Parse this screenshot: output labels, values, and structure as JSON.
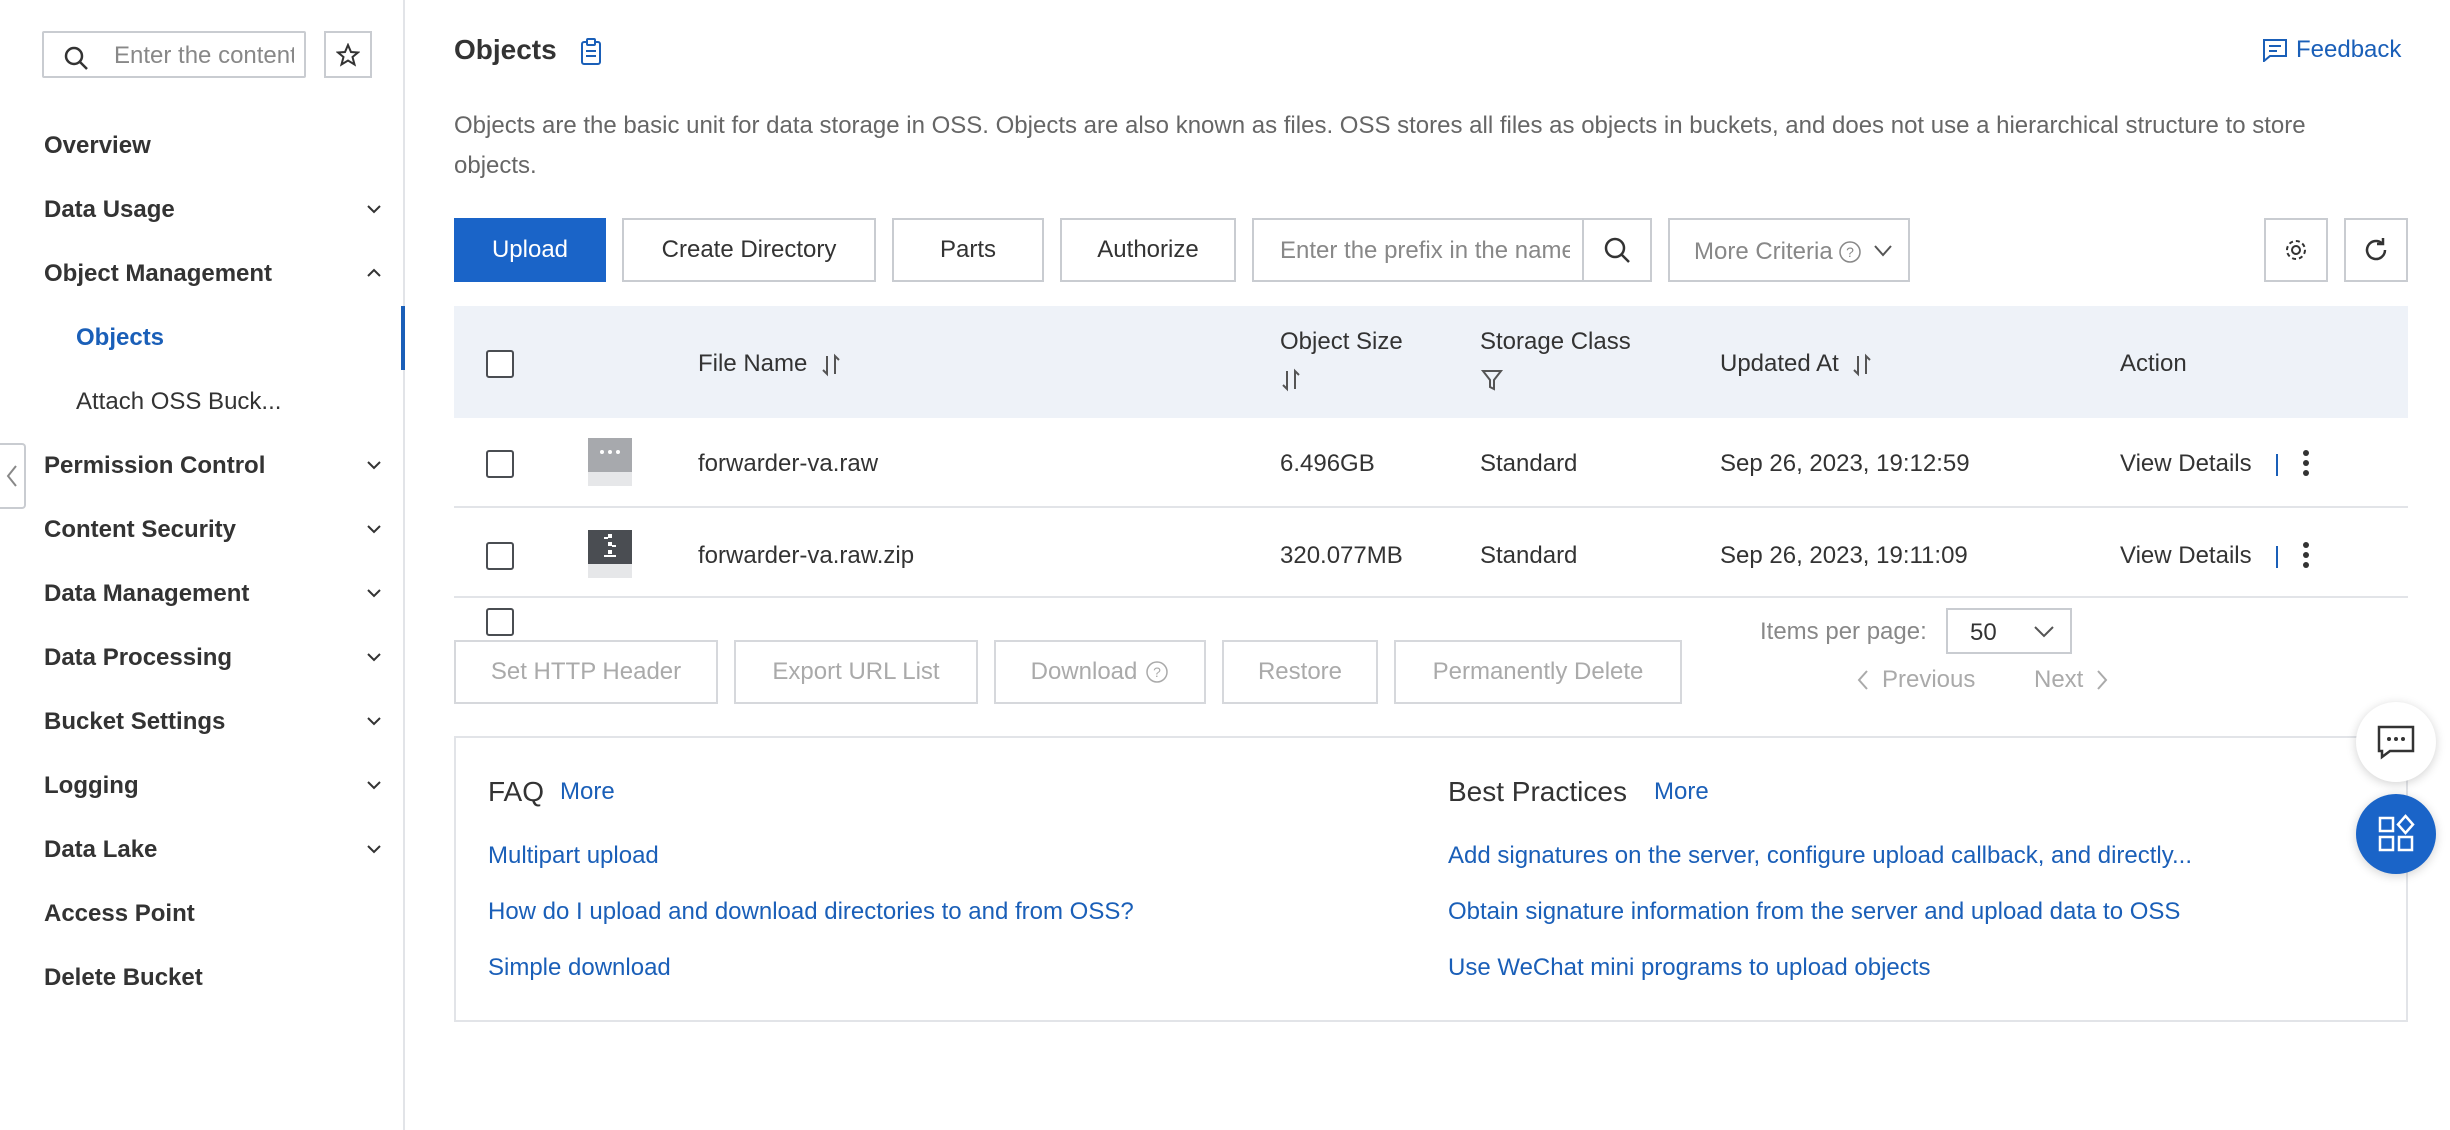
{
  "sidebar": {
    "search_placeholder": "Enter the content",
    "items": [
      {
        "label": "Overview"
      },
      {
        "label": "Data Usage"
      },
      {
        "label": "Object Management"
      },
      {
        "label": "Permission Control"
      },
      {
        "label": "Content Security"
      },
      {
        "label": "Data Management"
      },
      {
        "label": "Data Processing"
      },
      {
        "label": "Bucket Settings"
      },
      {
        "label": "Logging"
      },
      {
        "label": "Data Lake"
      },
      {
        "label": "Access Point"
      },
      {
        "label": "Delete Bucket"
      }
    ],
    "sub_items": [
      {
        "label": "Objects"
      },
      {
        "label": "Attach OSS Buck..."
      }
    ]
  },
  "header": {
    "title": "Objects",
    "feedback": "Feedback",
    "description": "Objects are the basic unit for data storage in OSS. Objects are also known as files. OSS stores all files as objects in buckets, and does not use a hierarchical structure to store objects."
  },
  "toolbar": {
    "upload": "Upload",
    "create_directory": "Create Directory",
    "parts": "Parts",
    "authorize": "Authorize",
    "prefix_placeholder": "Enter the prefix in the name",
    "more_criteria": "More Criteria"
  },
  "table": {
    "columns": {
      "file_name": "File Name",
      "object_size": "Object Size",
      "storage_class": "Storage Class",
      "updated_at": "Updated At",
      "action": "Action"
    },
    "rows": [
      {
        "name": "forwarder-va.raw",
        "size": "6.496GB",
        "storage_class": "Standard",
        "updated": "Sep 26, 2023, 19:12:59",
        "action": "View Details"
      },
      {
        "name": "forwarder-va.raw.zip",
        "size": "320.077MB",
        "storage_class": "Standard",
        "updated": "Sep 26, 2023, 19:11:09",
        "action": "View Details"
      }
    ]
  },
  "bulk": {
    "set_http_header": "Set HTTP Header",
    "export_url_list": "Export URL List",
    "download": "Download",
    "restore": "Restore",
    "permanently_delete": "Permanently Delete"
  },
  "pagination": {
    "items_per_page_label": "Items per page:",
    "items_per_page": "50",
    "previous": "Previous",
    "next": "Next"
  },
  "faq": {
    "title": "FAQ",
    "more": "More",
    "links": [
      "Multipart upload",
      "How do I upload and download directories to and from OSS?",
      "Simple download"
    ]
  },
  "best_practices": {
    "title": "Best Practices",
    "more": "More",
    "links": [
      "Add signatures on the server, configure upload callback, and directly...",
      "Obtain signature information from the server and upload data to OSS",
      "Use WeChat mini programs to upload objects"
    ]
  },
  "colors": {
    "brand": "#1a64c8",
    "link": "#1a5fb8",
    "header_bg": "#eef2f8"
  },
  "icons": [
    "search-icon",
    "star-icon",
    "chevron-down-icon",
    "chevron-up-icon",
    "chevron-left-icon",
    "document-icon",
    "feedback-icon",
    "gear-icon",
    "refresh-icon",
    "help-circle-icon",
    "sort-icon",
    "filter-icon",
    "more-vertical-icon",
    "chat-icon",
    "apps-icon"
  ]
}
